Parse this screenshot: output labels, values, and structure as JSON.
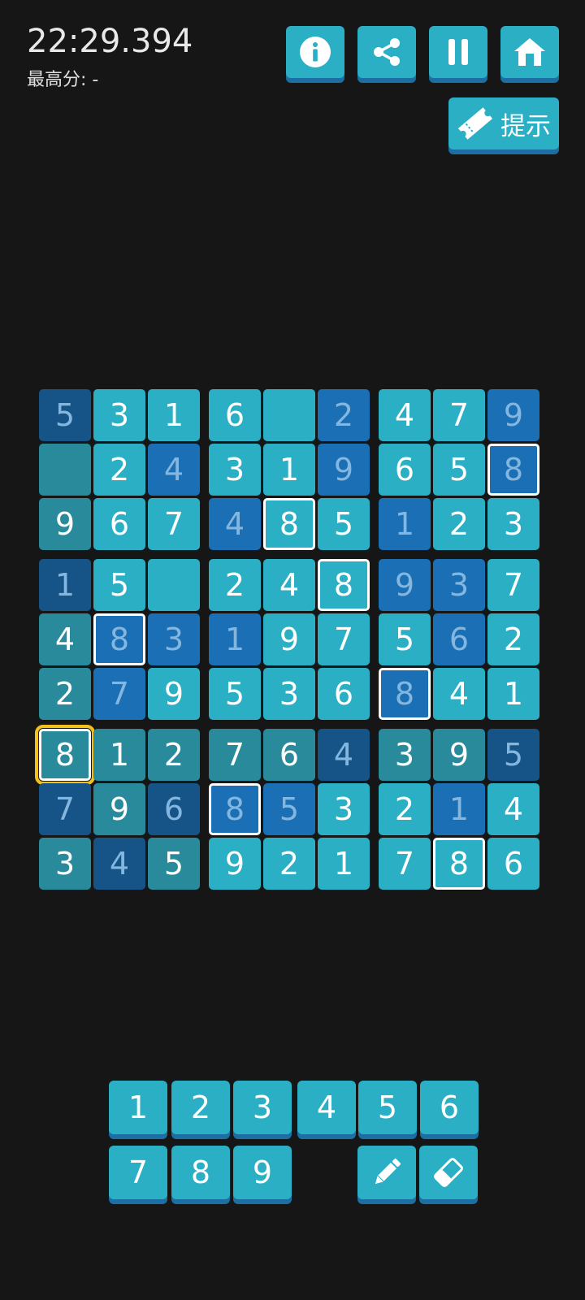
{
  "header": {
    "timer": "22:29.394",
    "best_score": "最高分: -"
  },
  "toolbar": {
    "buttons": [
      {
        "name": "info-button",
        "icon": "info-icon"
      },
      {
        "name": "share-button",
        "icon": "share-icon"
      },
      {
        "name": "pause-button",
        "icon": "pause-icon"
      },
      {
        "name": "home-button",
        "icon": "home-icon"
      }
    ],
    "hint_label": "提示",
    "hint_icon": "ticket-icon"
  },
  "colors": {
    "background": "#161616",
    "light_cell": "#2aafc4",
    "teal_cell": "#288a9b",
    "blue_cell": "#1b6fb5",
    "navy_cell": "#165488",
    "given_text": "#ffffff",
    "entered_text": "#84b7e0",
    "selection_outline": "#f2c21b",
    "highlight_border": "#ffffff"
  },
  "board": {
    "values": [
      [
        "5",
        "3",
        "1",
        "6",
        "",
        "2",
        "4",
        "7",
        "9"
      ],
      [
        "",
        "2",
        "4",
        "3",
        "1",
        "9",
        "6",
        "5",
        "8"
      ],
      [
        "9",
        "6",
        "7",
        "4",
        "8",
        "5",
        "1",
        "2",
        "3"
      ],
      [
        "1",
        "5",
        "",
        "2",
        "4",
        "8",
        "9",
        "3",
        "7"
      ],
      [
        "4",
        "8",
        "3",
        "1",
        "9",
        "7",
        "5",
        "6",
        "2"
      ],
      [
        "2",
        "7",
        "9",
        "5",
        "3",
        "6",
        "8",
        "4",
        "1"
      ],
      [
        "8",
        "1",
        "2",
        "7",
        "6",
        "4",
        "3",
        "9",
        "5"
      ],
      [
        "7",
        "9",
        "6",
        "8",
        "5",
        "3",
        "2",
        "1",
        "4"
      ],
      [
        "3",
        "4",
        "5",
        "9",
        "2",
        "1",
        "7",
        "8",
        "6"
      ]
    ],
    "selected_cell": [
      6,
      0
    ],
    "highlighted_digit": "8"
  },
  "keypad": {
    "row1": [
      "1",
      "2",
      "3",
      "4",
      "5",
      "6"
    ],
    "row2": [
      "7",
      "8",
      "9"
    ],
    "tools": [
      {
        "name": "pencil-button",
        "icon": "pencil-icon"
      },
      {
        "name": "eraser-button",
        "icon": "eraser-icon"
      }
    ]
  }
}
